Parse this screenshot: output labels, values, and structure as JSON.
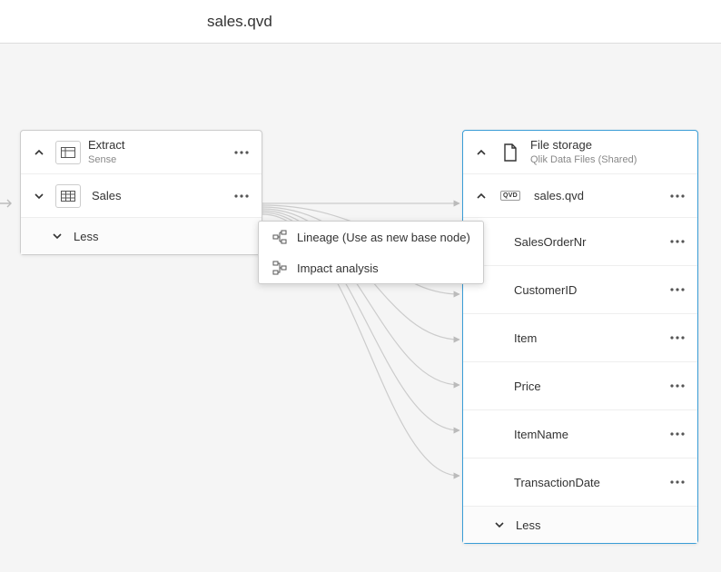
{
  "toolbar": {
    "title": "sales.qvd"
  },
  "nodes": {
    "source": {
      "title": "Extract",
      "subtitle": "Sense",
      "table_label": "Sales",
      "less_label": "Less"
    },
    "target": {
      "title": "File storage",
      "subtitle": "Qlik Data Files (Shared)",
      "file_label": "sales.qvd",
      "less_label": "Less",
      "fields": [
        "SalesOrderNr",
        "CustomerID",
        "Item",
        "Price",
        "ItemName",
        "TransactionDate"
      ]
    }
  },
  "context_menu": {
    "lineage": "Lineage (Use as new base node)",
    "impact": "Impact analysis"
  }
}
